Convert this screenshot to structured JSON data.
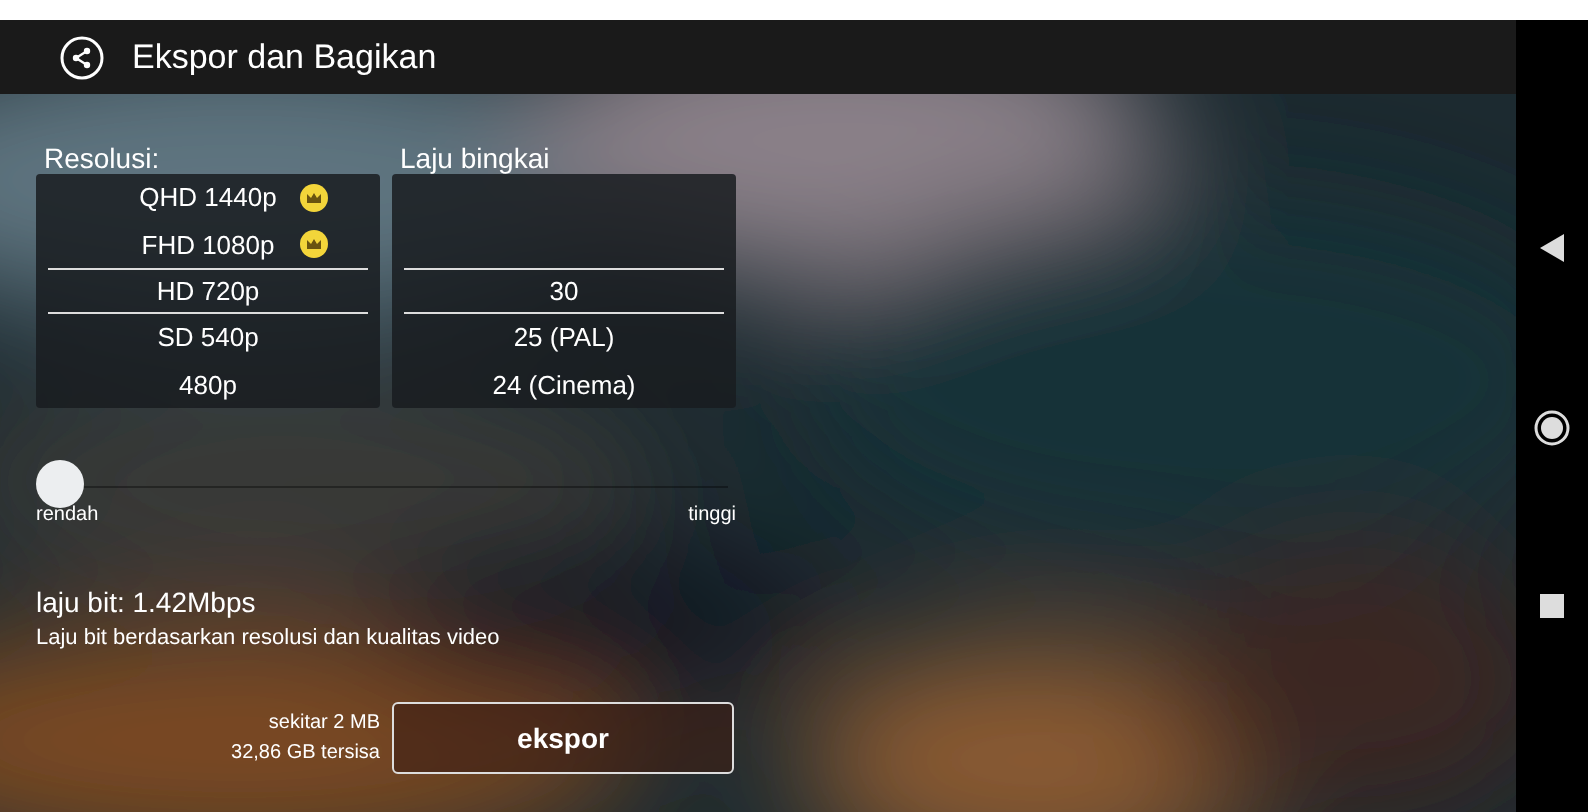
{
  "header": {
    "title": "Ekspor dan Bagikan"
  },
  "resolution": {
    "label": "Resolusi:",
    "items": [
      {
        "text": "QHD 1440p",
        "premium": true,
        "selected": false
      },
      {
        "text": "FHD 1080p",
        "premium": true,
        "selected": false
      },
      {
        "text": "HD 720p",
        "premium": false,
        "selected": true
      },
      {
        "text": "SD 540p",
        "premium": false,
        "selected": false
      },
      {
        "text": "480p",
        "premium": false,
        "selected": false
      }
    ]
  },
  "frame_rate": {
    "label": "Laju bingkai",
    "items": [
      {
        "text": "30",
        "selected": true
      },
      {
        "text": "25 (PAL)",
        "selected": false
      },
      {
        "text": "24 (Cinema)",
        "selected": false
      }
    ]
  },
  "quality": {
    "level": 0,
    "low_label": "rendah",
    "high_label": "tinggi"
  },
  "bitrate": {
    "value": "laju bit: 1.42Mbps",
    "description": "Laju bit berdasarkan resolusi dan kualitas video"
  },
  "size": {
    "estimate": "sekitar 2 MB",
    "free_space": "32,86 GB tersisa"
  },
  "export_button": "ekspor"
}
